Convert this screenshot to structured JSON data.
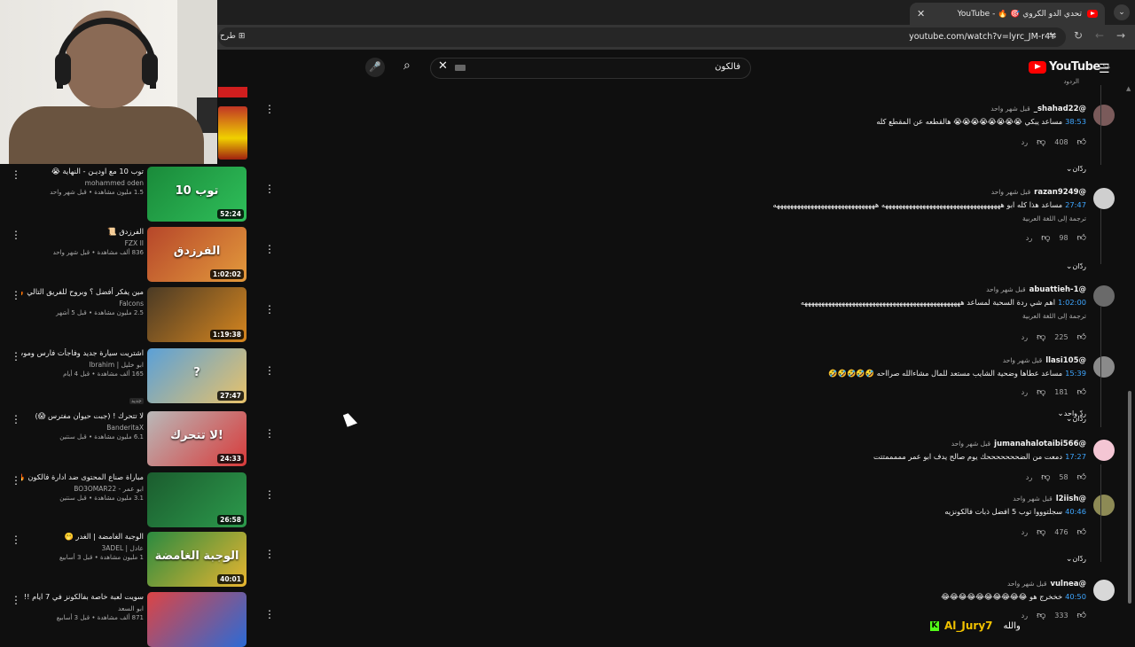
{
  "browser": {
    "tab_title": "تحدي الدو الكروي 🎯 🔥 - YouTube",
    "url": "youtube.com/watch?v=lyrc_JM-r4Y",
    "translate_label": "طرح"
  },
  "header": {
    "search_value": "فالكون",
    "brand": "YouTube",
    "brand_region": "SA"
  },
  "related": [
    {
      "title": "توب 10 مع اوديـن - النهاية 😭",
      "channel": "mohammed oden",
      "stats": "1.5 مليون مشاهدة • قبل شهر واحد",
      "duration": "52:24",
      "thumb": "توب 10",
      "colors": [
        "#1a8a3a",
        "#2fbf5a"
      ]
    },
    {
      "title": "الفرزدق 📜",
      "channel": "FZX II",
      "stats": "836 ألف مشاهدة • قبل شهر واحد",
      "duration": "1:02:02",
      "thumb": "الفرزدق",
      "colors": [
        "#b6462a",
        "#e39a3c"
      ]
    },
    {
      "title": "مين يفكر أفضل ؟ وبروح للفريق التالي 🔥",
      "channel": "Falcons",
      "stats": "2.5 مليون مشاهدة • قبل 5 أشهر",
      "duration": "1:19:38",
      "thumb": "",
      "colors": [
        "#4a3a25",
        "#d6861f"
      ]
    },
    {
      "title": "اشتريت سيارة جديد وفاجأت فارس وموسكو 🔥",
      "channel": "ابو خليل | Ibrahim",
      "stats": "165 ألف مشاهدة • قبل 4 أيام",
      "badge": "جديد",
      "duration": "27:47",
      "thumb": "?",
      "colors": [
        "#5aa0d8",
        "#e8c26a"
      ]
    },
    {
      "title": "لا تتحرك ! (جبت حيوان مفترس 😱)",
      "channel": "BanderitaX",
      "stats": "6.1 مليون مشاهدة • قبل سنتين",
      "duration": "24:33",
      "thumb": "لا تتحرك!",
      "colors": [
        "#b9b9b9",
        "#d83a3a"
      ]
    },
    {
      "title": "مباراة صناع المحتوى ضد ادارة فالكون 🔥",
      "channel": "ابو عمر - BO3OMAR22",
      "stats": "3.1 مليون مشاهدة • قبل سنتين",
      "duration": "26:58",
      "thumb": "",
      "colors": [
        "#1b5c2e",
        "#2c9a4c"
      ]
    },
    {
      "title": "الوجبة الغامضة | الغدر 🫢",
      "channel": "عادل | 3ADEL",
      "stats": "1 مليون مشاهدة • قبل 3 أسابيع",
      "duration": "40:01",
      "thumb": "الوجبة الغامضة",
      "colors": [
        "#2a8a40",
        "#e8b530"
      ]
    },
    {
      "title": "سويت لعبة خاصة بفالكونز في 7 ايام !!",
      "channel": "ابو السعد",
      "stats": "871 ألف مشاهدة • قبل 3 أسابيع",
      "duration": "",
      "thumb": "",
      "colors": [
        "#d44",
        "#2b6bd6"
      ]
    }
  ],
  "comments_top_label": "الردود",
  "comments": [
    {
      "user": "@shahad22_",
      "when": "قبل شهر واحد",
      "timestamp": "38:53",
      "text": "مساعد يبكي 😭😭😭😭😭😭😭😭 هالقطعه عن المقطع كله",
      "likes": "408",
      "reply": "رد",
      "replies_label": "ردّان",
      "translate": "",
      "avatar": "#7a5a5a"
    },
    {
      "user": "@razan9249",
      "when": "قبل شهر واحد",
      "timestamp": "27:47",
      "text": "مساعد هذا كله ابو هههههههههههههههههههههههههههههههههههه ههههههههههههههههههههههههههههههه",
      "likes": "98",
      "reply": "رد",
      "replies_label": "ردّان",
      "translate": "ترجمة إلى اللغة العربية",
      "avatar": "#cfcfcf"
    },
    {
      "user": "@abuattieh-1",
      "when": "قبل شهر واحد",
      "timestamp": "1:02:00",
      "text": "اهم شي ردة السحبة لمساعد هههههههههههههههههههههههههههههههههههههههههههههههه",
      "likes": "225",
      "reply": "رد",
      "replies_label": "ردّان",
      "translate": "ترجمة إلى اللغة العربية",
      "avatar": "#6a6a6a"
    },
    {
      "user": "@llasi105",
      "when": "قبل شهر واحد",
      "timestamp": "15:39",
      "text": "مساعد عطاها وضحية الشايب مستعد للمال مشاءالله صرااحه 🤣🤣🤣🤣🤣",
      "likes": "181",
      "reply": "رد",
      "replies_label": "ردّ واحد",
      "translate": "",
      "avatar": "#8a8a8a"
    },
    {
      "user": "@jumanahalotaibi566",
      "when": "قبل شهر واحد",
      "timestamp": "17:27",
      "text": "دمعت من الضحححححححك يوم صالح يدف ابو عمر مممممتتت",
      "likes": "58",
      "reply": "رد",
      "replies_label": "",
      "translate": "",
      "avatar": "#f4c6d4"
    },
    {
      "user": "@l2iish",
      "when": "قبل شهر واحد",
      "timestamp": "40:46",
      "text": "سجلتوووا توب 5 افضل ذبات فالكونزيه",
      "likes": "476",
      "reply": "رد",
      "replies_label": "ردّان",
      "translate": "",
      "avatar": "#8d8a55"
    },
    {
      "user": "@vulnea",
      "when": "قبل شهر واحد",
      "timestamp": "40:50",
      "text": "خخخرج هو 😂😂😂😂😂😂😂😂😂😂",
      "likes": "333",
      "reply": "رد",
      "replies_label": "",
      "translate": "",
      "avatar": "#d8d8d8"
    }
  ],
  "overlay": {
    "name": "Al_Jury7",
    "word": "والله",
    "badge": "K"
  }
}
